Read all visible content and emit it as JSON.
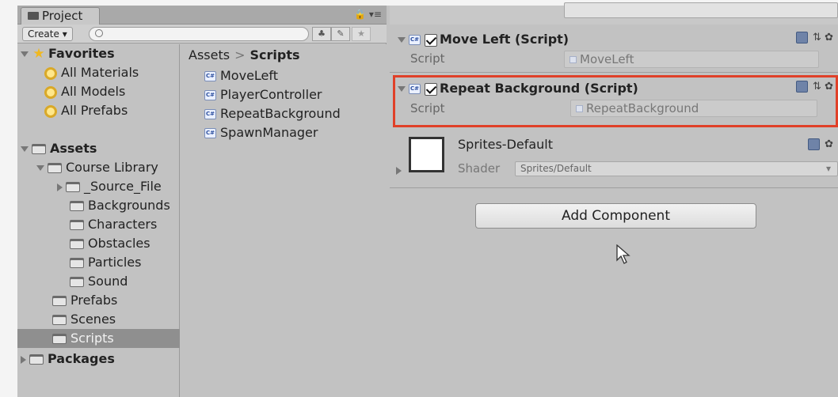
{
  "project": {
    "tab_label": "Project",
    "create_label": "Create ▾",
    "search_placeholder": "",
    "tree": {
      "favorites_label": "Favorites",
      "favorites": [
        "All Materials",
        "All Models",
        "All Prefabs"
      ],
      "assets_label": "Assets",
      "course_library": "Course Library",
      "course_children": [
        "_Source_File",
        "Backgrounds",
        "Characters",
        "Obstacles",
        "Particles",
        "Sound"
      ],
      "asset_folders": [
        "Prefabs",
        "Scenes",
        "Scripts"
      ],
      "packages_label": "Packages"
    },
    "breadcrumb": {
      "root": "Assets",
      "separator": ">",
      "current": "Scripts"
    },
    "files": [
      "MoveLeft",
      "PlayerController",
      "RepeatBackground",
      "SpawnManager"
    ]
  },
  "inspector": {
    "components": [
      {
        "title": "Move Left (Script)",
        "field_label": "Script",
        "field_value": "MoveLeft"
      },
      {
        "title": "Repeat Background (Script)",
        "field_label": "Script",
        "field_value": "RepeatBackground"
      }
    ],
    "material": {
      "name": "Sprites-Default",
      "shader_label": "Shader",
      "shader_value": "Sprites/Default"
    },
    "add_component_label": "Add Component"
  },
  "colors": {
    "highlight": "#e04028",
    "selection": "#8f8f8f"
  }
}
